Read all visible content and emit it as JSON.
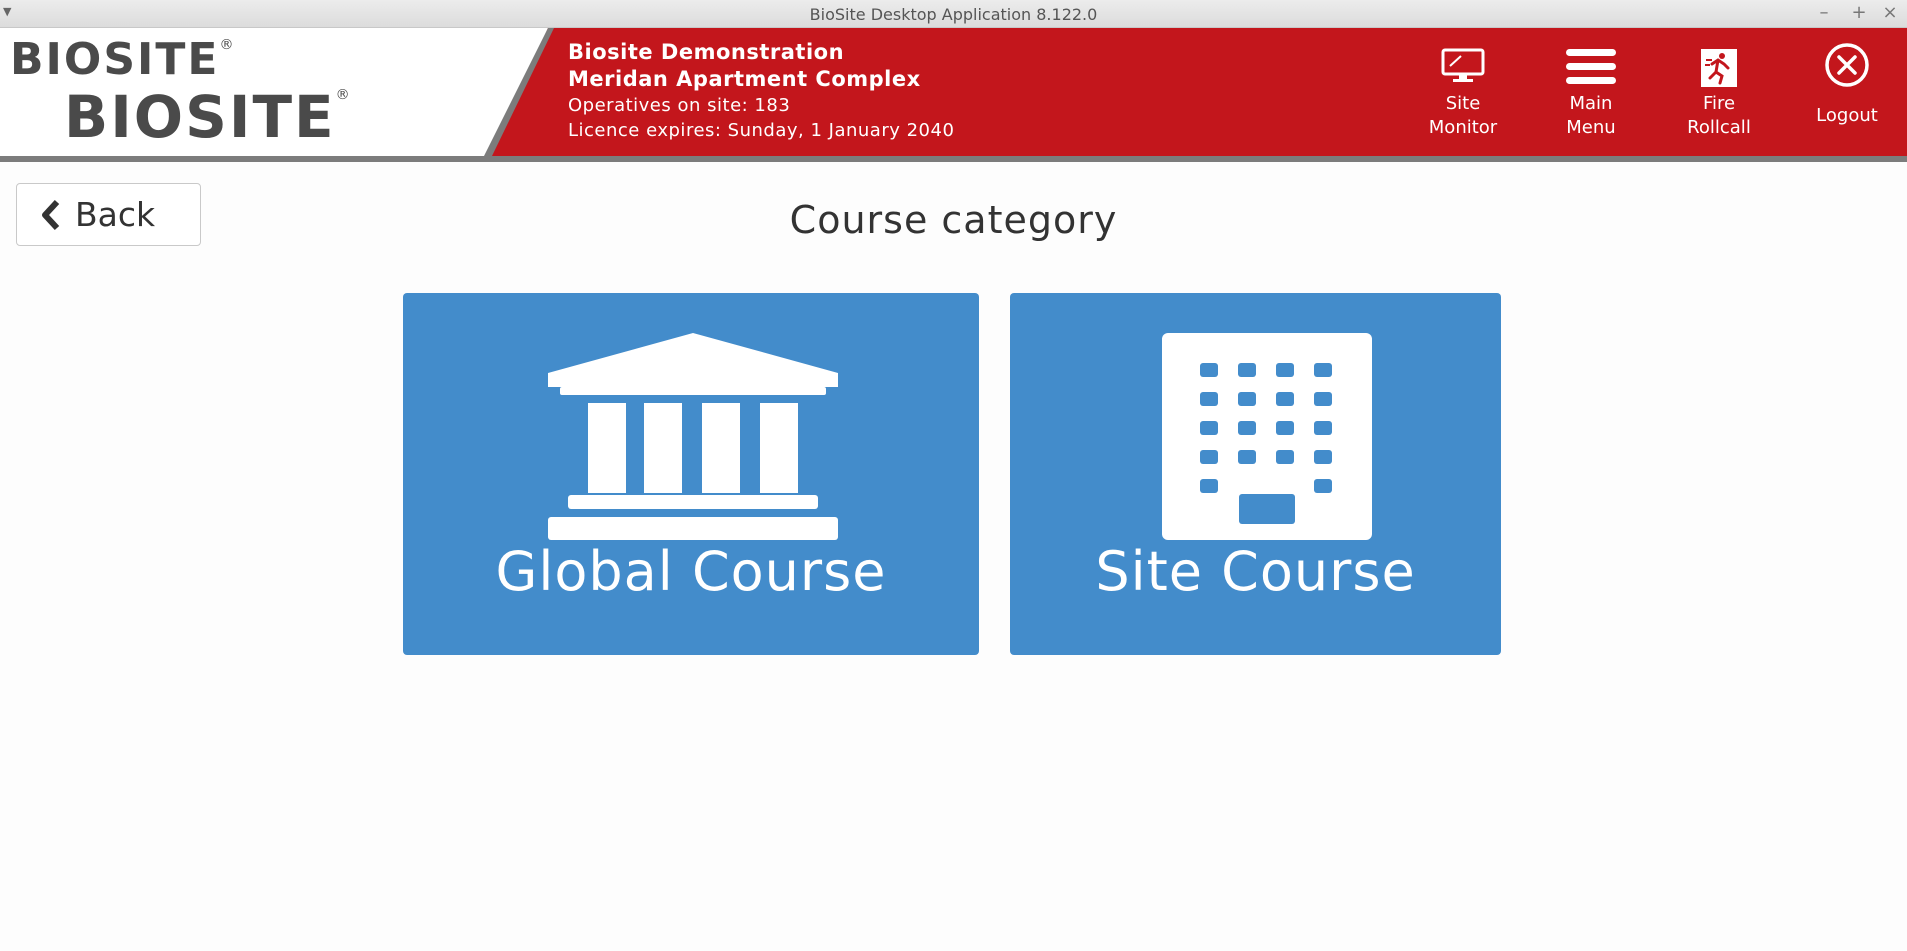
{
  "window": {
    "title": "BioSite Desktop Application 8.122.0",
    "controls": [
      "–",
      "+",
      "×"
    ]
  },
  "header": {
    "logo_top": "BIOSITE",
    "logo_bottom": "BIOSITE",
    "logo_mark": "®",
    "company": "Biosite Demonstration",
    "site": "Meridan Apartment Complex",
    "operatives": "Operatives on site: 183",
    "licence": "Licence expires: Sunday, 1 January 2040",
    "accent_color": "#c3161c",
    "buttons": [
      {
        "label_1": "Site",
        "label_2": "Monitor",
        "icon": "monitor-icon"
      },
      {
        "label_1": "Main",
        "label_2": "Menu",
        "icon": "hamburger-menu-icon"
      },
      {
        "label_1": "Fire",
        "label_2": "Rollcall",
        "icon": "fire-exit-icon"
      },
      {
        "label_1": "Logout",
        "label_2": "",
        "icon": "close-circle-icon"
      }
    ]
  },
  "page": {
    "back_label": "Back",
    "title": "Course category",
    "tile_color": "#438ccb",
    "tiles": [
      {
        "label": "Global Course",
        "icon": "institution-icon"
      },
      {
        "label": "Site Course",
        "icon": "building-icon"
      }
    ]
  }
}
